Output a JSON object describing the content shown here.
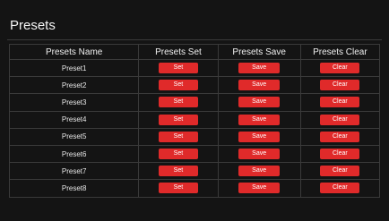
{
  "panel": {
    "title": "Presets"
  },
  "table": {
    "headers": [
      "Presets Name",
      "Presets Set",
      "Presets Save",
      "Presets Clear"
    ],
    "rows": [
      {
        "name": "Preset1",
        "set_label": "Set",
        "save_label": "Save",
        "clear_label": "Clear"
      },
      {
        "name": "Preset2",
        "set_label": "Set",
        "save_label": "Save",
        "clear_label": "Clear"
      },
      {
        "name": "Preset3",
        "set_label": "Set",
        "save_label": "Save",
        "clear_label": "Clear"
      },
      {
        "name": "Preset4",
        "set_label": "Set",
        "save_label": "Save",
        "clear_label": "Clear"
      },
      {
        "name": "Preset5",
        "set_label": "Set",
        "save_label": "Save",
        "clear_label": "Clear"
      },
      {
        "name": "Preset6",
        "set_label": "Set",
        "save_label": "Save",
        "clear_label": "Clear"
      },
      {
        "name": "Preset7",
        "set_label": "Set",
        "save_label": "Save",
        "clear_label": "Clear"
      },
      {
        "name": "Preset8",
        "set_label": "Set",
        "save_label": "Save",
        "clear_label": "Clear"
      }
    ]
  },
  "colors": {
    "background": "#141414",
    "button_red": "#e02a2a",
    "border": "#3a3a3a"
  }
}
